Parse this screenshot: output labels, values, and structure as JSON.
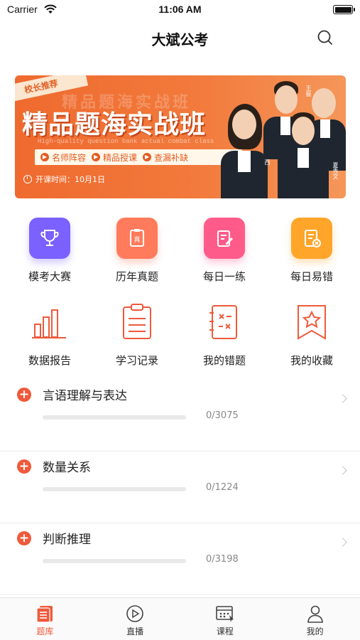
{
  "status_bar": {
    "carrier": "Carrier",
    "time": "11:06 AM"
  },
  "nav": {
    "title": "大斌公考"
  },
  "banner": {
    "ribbon": "校长推荐",
    "ghost_text": "精品题海实战班",
    "title": "精品题海实战班",
    "subtitle": "High-quality question bank actual combat class",
    "tags": [
      "名师阵容",
      "精品授课",
      "查漏补缺"
    ],
    "date": "开课时间：10月1日",
    "teachers": [
      "西西",
      "夏秀文",
      "王振"
    ]
  },
  "quick_actions": [
    {
      "label": "模考大赛",
      "icon": "trophy-icon",
      "color": "#7b61ff"
    },
    {
      "label": "历年真题",
      "icon": "exam-paper-icon",
      "color": "#ff7b5c"
    },
    {
      "label": "每日一练",
      "icon": "daily-practice-icon",
      "color": "#ff5b8a"
    },
    {
      "label": "每日易错",
      "icon": "error-doc-icon",
      "color": "#ffa52a"
    }
  ],
  "tools": [
    {
      "label": "数据报告",
      "icon": "bar-chart-icon"
    },
    {
      "label": "学习记录",
      "icon": "clipboard-icon"
    },
    {
      "label": "我的错题",
      "icon": "wrong-questions-icon"
    },
    {
      "label": "我的收藏",
      "icon": "bookmark-star-icon"
    }
  ],
  "categories": [
    {
      "name": "言语理解与表达",
      "count": "0/3075",
      "progress": 0
    },
    {
      "name": "数量关系",
      "count": "0/1224",
      "progress": 0
    },
    {
      "name": "判断推理",
      "count": "0/3198",
      "progress": 0
    }
  ],
  "tabs": [
    {
      "label": "题库",
      "active": true
    },
    {
      "label": "直播",
      "active": false
    },
    {
      "label": "课程",
      "active": false
    },
    {
      "label": "我的",
      "active": false
    }
  ],
  "colors": {
    "accent": "#ee5a3b",
    "banner": "#ef6a2f"
  }
}
